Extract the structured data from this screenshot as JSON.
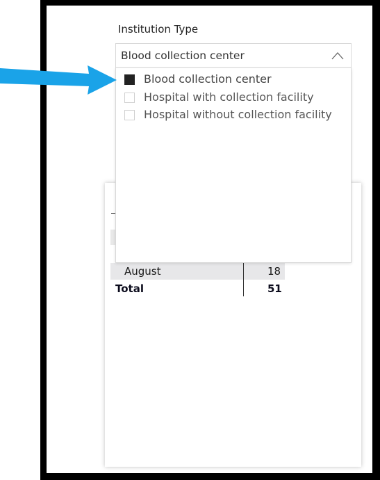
{
  "slicer": {
    "title": "Institution Type",
    "selected_value": "Blood collection center",
    "options": [
      {
        "label": "Blood collection center",
        "checked": true
      },
      {
        "label": "Hospital with collection facility",
        "checked": false
      },
      {
        "label": "Hospital without collection facility",
        "checked": false
      }
    ]
  },
  "table": {
    "rows": [
      {
        "month": "August",
        "value": "18"
      }
    ],
    "total": {
      "label": "Total",
      "value": "51"
    }
  },
  "annotation": {
    "arrow_color": "#1aa3e8"
  }
}
